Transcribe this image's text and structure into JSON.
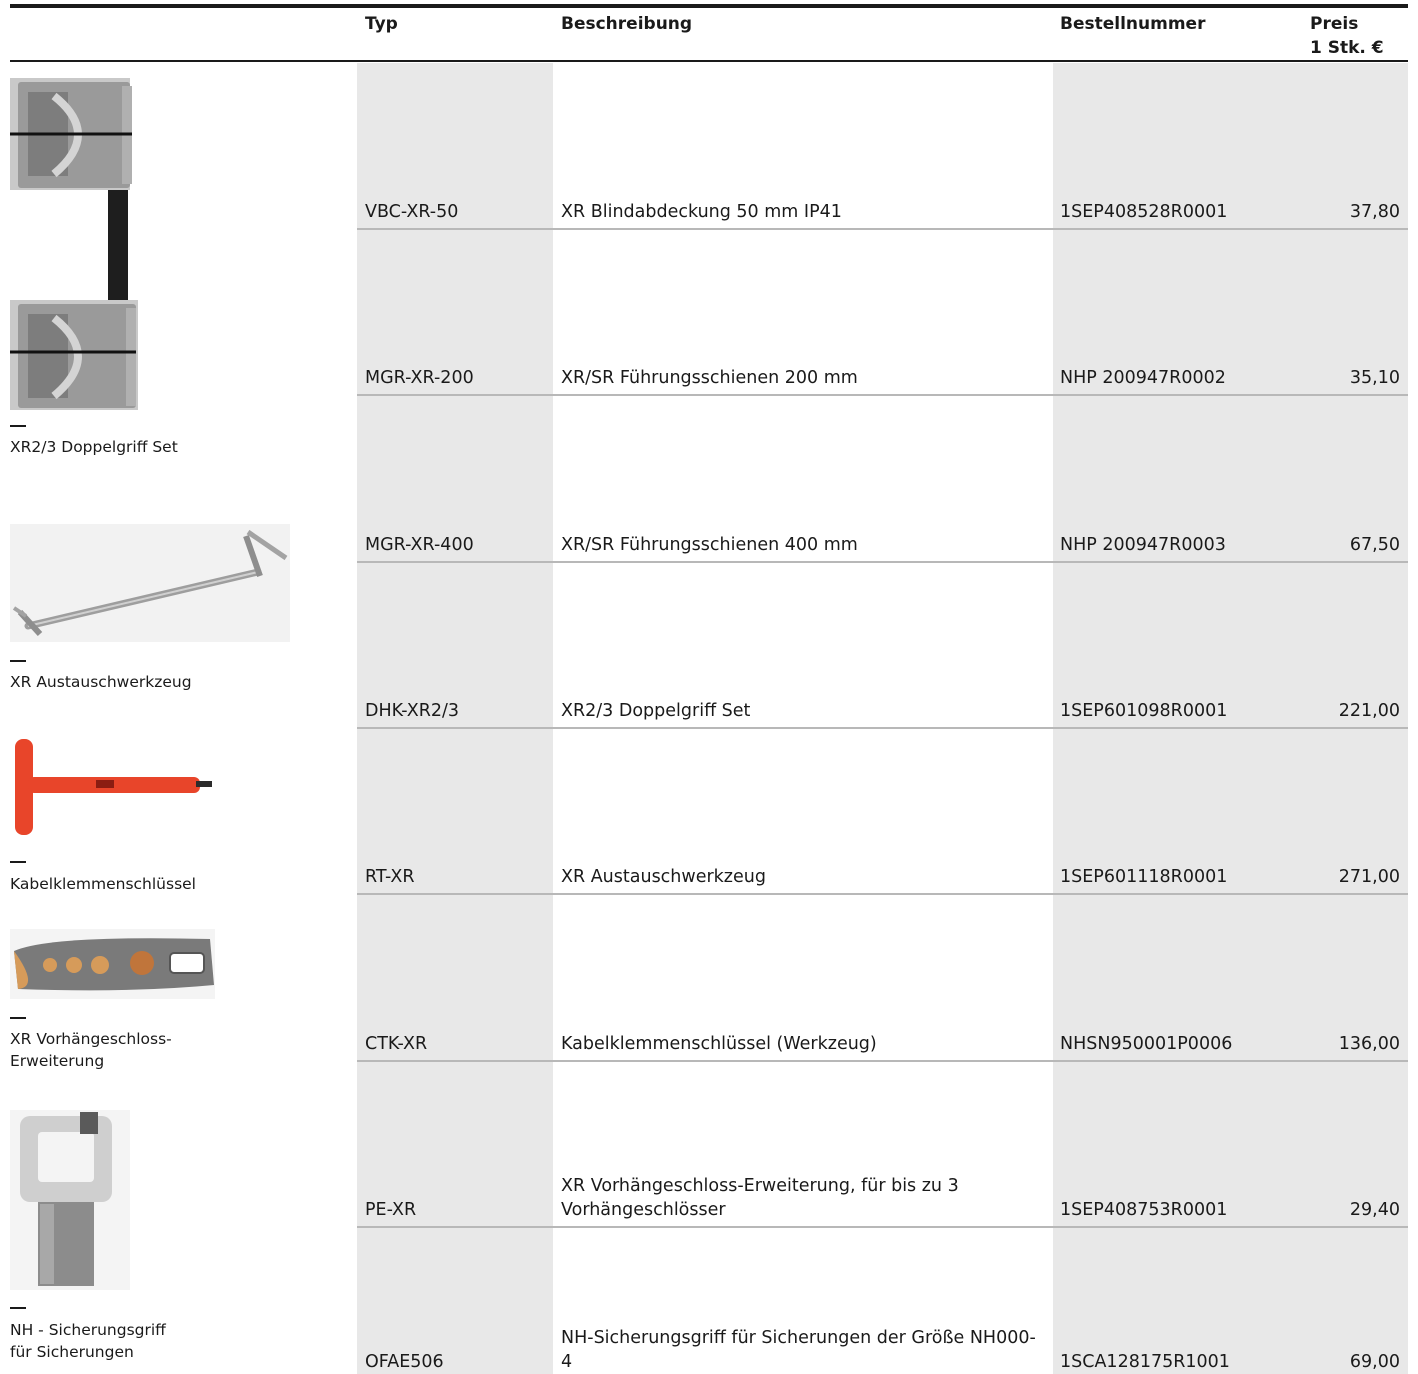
{
  "table": {
    "headers": {
      "typ": "Typ",
      "beschreibung": "Beschreibung",
      "bestellnummer": "Bestellnummer",
      "preis_line1": "Preis",
      "preis_line2": "1 Stk. €"
    },
    "rows": [
      {
        "typ": "VBC-XR-50",
        "beschreibung": "XR Blindabdeckung 50 mm IP41",
        "bestellnummer": "1SEP408528R0001",
        "preis": "37,80"
      },
      {
        "typ": "MGR-XR-200",
        "beschreibung": "XR/SR Führungsschienen 200 mm",
        "bestellnummer": "NHP 200947R0002",
        "preis": "35,10"
      },
      {
        "typ": "MGR-XR-400",
        "beschreibung": "XR/SR Führungsschienen 400 mm",
        "bestellnummer": "NHP 200947R0003",
        "preis": "67,50"
      },
      {
        "typ": "DHK-XR2/3",
        "beschreibung": "XR2/3 Doppelgriff Set",
        "bestellnummer": "1SEP601098R0001",
        "preis": "221,00"
      },
      {
        "typ": "RT-XR",
        "beschreibung": "XR Austauschwerkzeug",
        "bestellnummer": "1SEP601118R0001",
        "preis": "271,00"
      },
      {
        "typ": "CTK-XR",
        "beschreibung": "Kabelklemmenschlüssel (Werkzeug)",
        "bestellnummer": "NHSN950001P0006",
        "preis": "136,00"
      },
      {
        "typ": "PE-XR",
        "beschreibung": "XR Vorhängeschloss-Erweiterung, für bis zu 3 Vorhängeschlösser",
        "bestellnummer": "1SEP408753R0001",
        "preis": "29,40"
      },
      {
        "typ": "OFAE506",
        "beschreibung": "NH-Sicherungsgriff für Sicherungen der Größe NH000-4",
        "bestellnummer": "1SCA128175R1001",
        "preis": "69,00"
      }
    ]
  },
  "captions": {
    "doppelgriff": "XR2/3 Doppelgriff Set",
    "austauschwerkzeug": "XR Austauschwerkzeug",
    "kabelklemmenschluessel": "Kabelklemmenschlüssel",
    "vorhaengeschloss": "XR Vorhängeschloss-\nErweiterung",
    "sicherungsgriff": "NH - Sicherungsgriff\nfür Sicherungen"
  },
  "colors": {
    "shaded_column": "#e8e8e8",
    "row_divider": "#b8b8b8",
    "rule": "#1a1a1a",
    "tool_orange": "#e8452a"
  }
}
